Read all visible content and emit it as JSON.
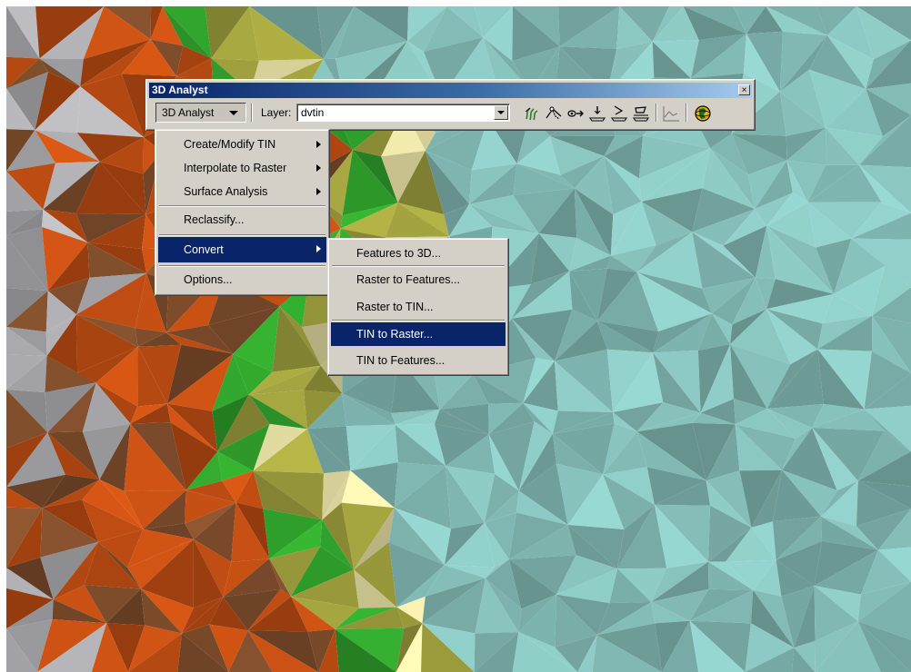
{
  "toolbar": {
    "title": "3D Analyst",
    "close_glyph": "×",
    "menu_button_label": "3D Analyst",
    "layer_label": "Layer:",
    "layer_value": "dvtin",
    "tools": [
      {
        "name": "contour-tool-icon"
      },
      {
        "name": "steepest-path-tool-icon"
      },
      {
        "name": "line-of-sight-tool-icon"
      },
      {
        "name": "interpolate-point-tool-icon"
      },
      {
        "name": "interpolate-line-tool-icon"
      },
      {
        "name": "interpolate-polygon-tool-icon"
      },
      {
        "name": "create-profile-graph-icon"
      },
      {
        "name": "arcscene-globe-icon"
      }
    ]
  },
  "main_menu": {
    "items": [
      {
        "label": "Create/Modify TIN",
        "submenu": true
      },
      {
        "label": "Interpolate to Raster",
        "submenu": true
      },
      {
        "label": "Surface Analysis",
        "submenu": true
      },
      {
        "label": "Reclassify...",
        "submenu": false
      },
      {
        "label": "Convert",
        "submenu": true,
        "selected": true
      },
      {
        "label": "Options...",
        "submenu": false
      }
    ]
  },
  "convert_submenu": {
    "items": [
      {
        "label": "Features to 3D..."
      },
      {
        "label": "Raster to Features..."
      },
      {
        "label": "Raster to TIN..."
      },
      {
        "label": "TIN to Raster...",
        "selected": true
      },
      {
        "label": "TIN to Features..."
      }
    ]
  },
  "colors": {
    "selection": "#0a246a",
    "face": "#d4d0c8",
    "tin_water": "#7fb5b0",
    "tin_brown": "#b84a12",
    "tin_green": "#2e9a2a",
    "tin_gray": "#a8a8ac",
    "tin_olive": "#9a9a3c"
  }
}
